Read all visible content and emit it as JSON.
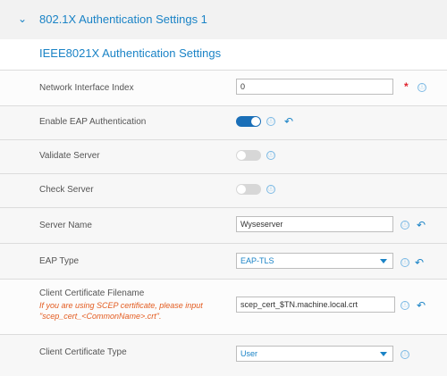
{
  "section": {
    "title": "802.1X Authentication Settings 1",
    "subtitle": "IEEE8021X Authentication Settings"
  },
  "fields": {
    "network_interface_index": {
      "label": "Network Interface Index",
      "value": "0"
    },
    "enable_eap": {
      "label": "Enable EAP Authentication",
      "state": "on"
    },
    "validate_server": {
      "label": "Validate Server",
      "state": "off"
    },
    "check_server": {
      "label": "Check Server",
      "state": "off"
    },
    "server_name": {
      "label": "Server Name",
      "value": "Wyseserver"
    },
    "eap_type": {
      "label": "EAP Type",
      "value": "EAP-TLS"
    },
    "client_cert_filename": {
      "label": "Client Certificate Filename",
      "helper": "If you are using SCEP certificate, please input \"scep_cert_<CommonName>.crt\".",
      "value": "scep_cert_$TN.machine.local.crt"
    },
    "client_cert_type": {
      "label": "Client Certificate Type",
      "value": "User"
    }
  },
  "icons": {
    "info": "ⓘ",
    "undo": "↶",
    "chevron": "⌄",
    "required": "*"
  },
  "colors": {
    "accent": "#1a83c6",
    "required": "#e0232e",
    "helper": "#e35b1f",
    "toggle_on": "#1a6fb8",
    "toggle_off": "#d7d7d7"
  }
}
